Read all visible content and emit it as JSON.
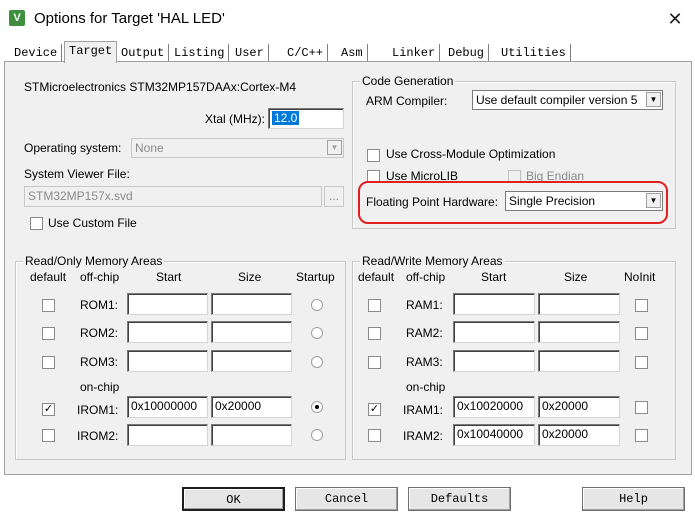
{
  "window": {
    "title": "Options for Target 'HAL LED'",
    "icon": "keil-uvision-icon",
    "close": "✕"
  },
  "tabs": [
    "Device",
    "Target",
    "Output",
    "Listing",
    "User",
    "C/C++",
    "Asm",
    "Linker",
    "Debug",
    "Utilities"
  ],
  "active_tab": "Target",
  "device": {
    "name": "STMicroelectronics STM32MP157DAAx:Cortex-M4",
    "xtal_label": "Xtal (MHz):",
    "xtal_value": "12.0",
    "os_label": "Operating system:",
    "os_value": "None",
    "svd_label": "System Viewer File:",
    "svd_value": "STM32MP157x.svd",
    "svd_browse": "...",
    "custom_file_label": "Use Custom File"
  },
  "code_gen": {
    "title": "Code Generation",
    "compiler_label": "ARM Compiler:",
    "compiler_value": "Use default compiler version 5",
    "cross_module_label": "Use Cross-Module Optimization",
    "microlib_label": "Use MicroLIB",
    "big_endian_label": "Big Endian",
    "fpu_label": "Floating Point Hardware:",
    "fpu_value": "Single Precision"
  },
  "ro_memory": {
    "title": "Read/Only Memory Areas",
    "headers": {
      "default": "default",
      "offchip": "off-chip",
      "start": "Start",
      "size": "Size",
      "startup": "Startup"
    },
    "onchip_label": "on-chip",
    "rows": [
      {
        "name": "ROM1:",
        "start": "",
        "size": "",
        "default": false,
        "startup": false
      },
      {
        "name": "ROM2:",
        "start": "",
        "size": "",
        "default": false,
        "startup": false
      },
      {
        "name": "ROM3:",
        "start": "",
        "size": "",
        "default": false,
        "startup": false
      },
      {
        "name": "IROM1:",
        "start": "0x10000000",
        "size": "0x20000",
        "default": true,
        "startup": true
      },
      {
        "name": "IROM2:",
        "start": "",
        "size": "",
        "default": false,
        "startup": false
      }
    ]
  },
  "rw_memory": {
    "title": "Read/Write Memory Areas",
    "headers": {
      "default": "default",
      "offchip": "off-chip",
      "start": "Start",
      "size": "Size",
      "noinit": "NoInit"
    },
    "onchip_label": "on-chip",
    "rows": [
      {
        "name": "RAM1:",
        "start": "",
        "size": "",
        "default": false,
        "noinit": false
      },
      {
        "name": "RAM2:",
        "start": "",
        "size": "",
        "default": false,
        "noinit": false
      },
      {
        "name": "RAM3:",
        "start": "",
        "size": "",
        "default": false,
        "noinit": false
      },
      {
        "name": "IRAM1:",
        "start": "0x10020000",
        "size": "0x20000",
        "default": true,
        "noinit": false
      },
      {
        "name": "IRAM2:",
        "start": "0x10040000",
        "size": "0x20000",
        "default": false,
        "noinit": false
      }
    ]
  },
  "buttons": {
    "ok": "OK",
    "cancel": "Cancel",
    "defaults": "Defaults",
    "help": "Help"
  },
  "colors": {
    "highlight": "#e02020",
    "selection": "#0078d7",
    "dialog": "#f0f0f0"
  }
}
